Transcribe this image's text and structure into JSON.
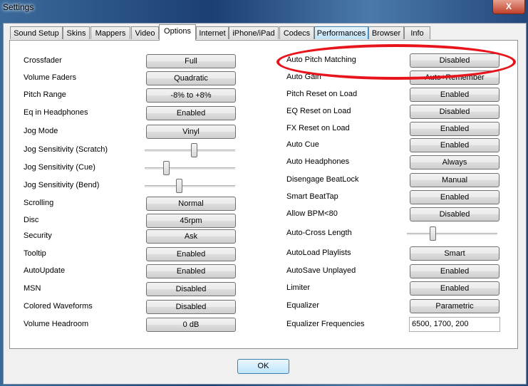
{
  "window": {
    "title": "Settings",
    "close_label": "X"
  },
  "tabs": [
    {
      "label": "Sound Setup",
      "active": false
    },
    {
      "label": "Skins",
      "active": false
    },
    {
      "label": "Mappers",
      "active": false
    },
    {
      "label": "Video",
      "active": false
    },
    {
      "label": "Options",
      "active": true
    },
    {
      "label": "Internet",
      "active": false
    },
    {
      "label": "iPhone/iPad",
      "active": false
    },
    {
      "label": "Codecs",
      "active": false
    },
    {
      "label": "Performances",
      "active": false,
      "hovered": true
    },
    {
      "label": "Browser",
      "active": false
    },
    {
      "label": "Info",
      "active": false
    }
  ],
  "left": [
    {
      "label": "Crossfader",
      "type": "button",
      "value": "Full"
    },
    {
      "label": "Volume Faders",
      "type": "button",
      "value": "Quadratic"
    },
    {
      "label": "Pitch Range",
      "type": "button",
      "value": "-8% to +8%"
    },
    {
      "label": "Eq in Headphones",
      "type": "button",
      "value": "Enabled"
    },
    {
      "label": "Jog Mode",
      "type": "button",
      "value": "Vinyl"
    },
    {
      "label": "Jog Sensitivity (Scratch)",
      "type": "slider",
      "level": 0.55
    },
    {
      "label": "Jog Sensitivity (Cue)",
      "type": "slider",
      "level": 0.22
    },
    {
      "label": "Jog Sensitivity (Bend)",
      "type": "slider",
      "level": 0.37
    },
    {
      "label": "Scrolling",
      "type": "button",
      "value": "Normal"
    },
    {
      "label": "Disc",
      "type": "button",
      "value": "45rpm"
    },
    {
      "label": "Security",
      "type": "button",
      "value": "Ask"
    },
    {
      "label": "Tooltip",
      "type": "button",
      "value": "Enabled"
    },
    {
      "label": "AutoUpdate",
      "type": "button",
      "value": "Enabled"
    },
    {
      "label": "MSN",
      "type": "button",
      "value": "Disabled"
    },
    {
      "label": "Colored Waveforms",
      "type": "button",
      "value": "Disabled"
    },
    {
      "label": "Volume Headroom",
      "type": "button",
      "value": "0 dB"
    }
  ],
  "right": [
    {
      "label": "Auto Pitch Matching",
      "type": "button",
      "value": "Disabled",
      "highlighted": true
    },
    {
      "label": "Auto Gain",
      "type": "button",
      "value": "Auto+Remember"
    },
    {
      "label": "Pitch Reset on Load",
      "type": "button",
      "value": "Enabled"
    },
    {
      "label": "EQ Reset on Load",
      "type": "button",
      "value": "Disabled"
    },
    {
      "label": "FX Reset on Load",
      "type": "button",
      "value": "Enabled"
    },
    {
      "label": "Auto Cue",
      "type": "button",
      "value": "Enabled"
    },
    {
      "label": "Auto Headphones",
      "type": "button",
      "value": "Always"
    },
    {
      "label": "Disengage BeatLock",
      "type": "button",
      "value": "Manual"
    },
    {
      "label": "Smart BeatTap",
      "type": "button",
      "value": "Enabled"
    },
    {
      "label": "Allow BPM<80",
      "type": "button",
      "value": "Disabled"
    },
    {
      "label": "Auto-Cross Length",
      "type": "slider",
      "level": 0.27
    },
    {
      "label": "AutoLoad Playlists",
      "type": "button",
      "value": "Smart"
    },
    {
      "label": "AutoSave Unplayed",
      "type": "button",
      "value": "Enabled"
    },
    {
      "label": "Limiter",
      "type": "button",
      "value": "Enabled"
    },
    {
      "label": "Equalizer",
      "type": "button",
      "value": "Parametric"
    },
    {
      "label": "Equalizer Frequencies",
      "type": "input",
      "value": "6500, 1700, 200"
    }
  ],
  "ok_label": "OK",
  "highlight_color": "#e8141c"
}
